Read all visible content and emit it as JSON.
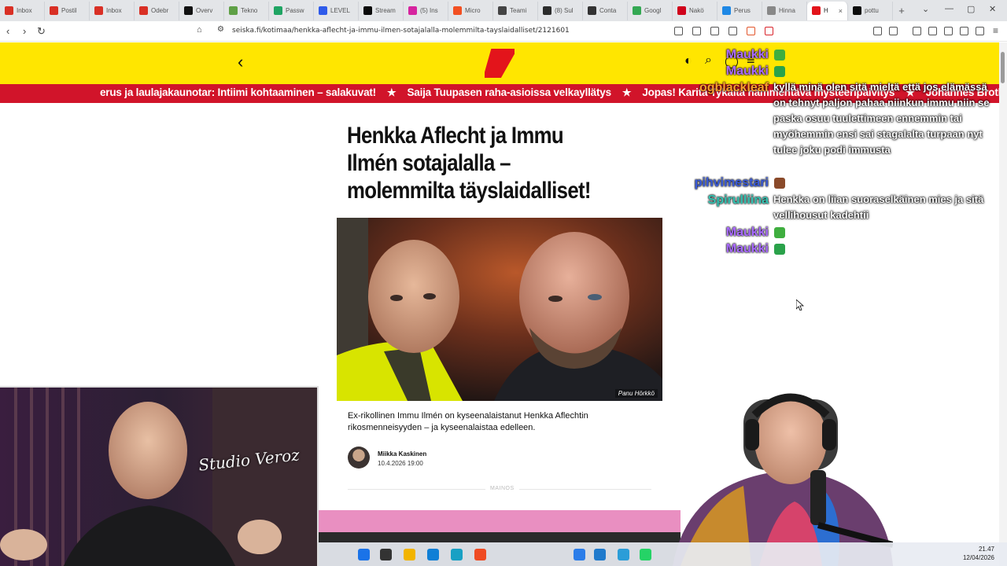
{
  "browser": {
    "tabs": [
      {
        "label": "Inbox",
        "color": "#d93025"
      },
      {
        "label": "Postil",
        "color": "#d93025"
      },
      {
        "label": "Inbox",
        "color": "#d93025"
      },
      {
        "label": "Odebr",
        "color": "#d93025"
      },
      {
        "label": "Overv",
        "color": "#111111"
      },
      {
        "label": "Tekno",
        "color": "#5fa046"
      },
      {
        "label": "Passw",
        "color": "#1fa463"
      },
      {
        "label": "LEVEL",
        "color": "#2f5bea"
      },
      {
        "label": "Stream",
        "color": "#0a0a0a"
      },
      {
        "label": "(5) Ins",
        "color": "#d6249f"
      },
      {
        "label": "Micro",
        "color": "#f25022"
      },
      {
        "label": "Teami",
        "color": "#444444"
      },
      {
        "label": "(8) Sul",
        "color": "#2b2b2b"
      },
      {
        "label": "Conta",
        "color": "#333333"
      },
      {
        "label": "Googl",
        "color": "#34a853"
      },
      {
        "label": "Nakö",
        "color": "#d0021b"
      },
      {
        "label": "Perus",
        "color": "#1e88e5"
      },
      {
        "label": "Hinna",
        "color": "#888888"
      },
      {
        "label": "H",
        "color": "#e3141b"
      },
      {
        "label": "pottu",
        "color": "#0a0a0a"
      }
    ],
    "url": "seiska.fi/kotimaa/henkka-aflecht-ja-immu-ilmen-sotajalalla-molemmilta-tayslaidalliset/2121601"
  },
  "ticker": {
    "items": [
      "erus ja laulajakaunotar: Intiimi kohtaaminen – salakuvat!",
      "Saija Tuupasen raha-asioissa velkayllätys",
      "Jopas! Karita Tykältä hämmentävä mysteeripäivitys",
      "Johannes Brothers"
    ],
    "star": "★"
  },
  "article": {
    "headline": "Henkka Aflecht ja Immu Ilmén sotajalalla – molemmilta täyslaidalliset!",
    "photo_credit": "Panu Hörkkö",
    "lead": "Ex-rikollinen Immu Ilmén on kyseenalaistanut Henkka Aflechtin rikosmenneisyyden – ja kyseenalaistaa edelleen.",
    "author": "Miikka Kaskinen",
    "date": "10.4.2026 19:00",
    "ad_label": "MAINOS"
  },
  "chat": {
    "messages": [
      {
        "user": "Maukki",
        "color": "#a96bff",
        "text": ""
      },
      {
        "user": "Maukki",
        "color": "#a96bff",
        "text": ""
      },
      {
        "user": "ogblackleaf",
        "color": "#ff9e2c",
        "text": "kyllä minä olen sitä mieltä että jos elämässä on tehnyt paljon pahaa niinkun immu niin se paska osuu tuulettimeen ennemmin tai myöhemmin ensi sai stagalalta turpaan nyt tulee joku podi immusta"
      },
      {
        "user": "pihvimestari",
        "color": "#3a5bd9",
        "text": ""
      },
      {
        "user": "Spirulliina",
        "color": "#35c3b3",
        "text": "Henkka on liian suoraselkäinen mies ja sitä vellihousut kadehtii"
      },
      {
        "user": "Maukki",
        "color": "#a96bff",
        "text": ""
      },
      {
        "user": "Maukki",
        "color": "#a96bff",
        "text": ""
      }
    ]
  },
  "webcam": {
    "overlay_text": "Studio Veroz"
  },
  "taskbar": {
    "time": "21.47",
    "date": "12/04/2026"
  }
}
